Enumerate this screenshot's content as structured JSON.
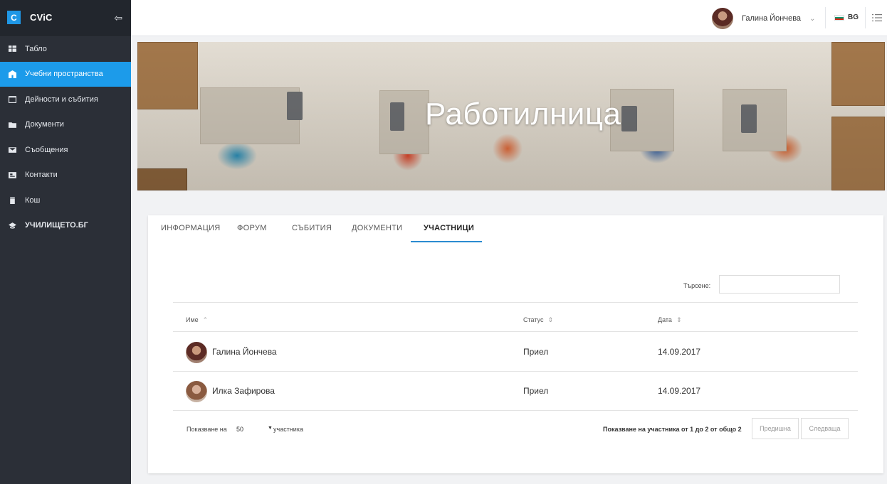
{
  "brand": {
    "logo_letter": "C",
    "name": "CViC"
  },
  "sidebar": {
    "items": [
      {
        "label": "Табло",
        "icon": "dashboard-icon"
      },
      {
        "label": "Учебни пространства",
        "icon": "building-icon",
        "active": true
      },
      {
        "label": "Дейности и събития",
        "icon": "calendar-icon"
      },
      {
        "label": "Документи",
        "icon": "folder-icon"
      },
      {
        "label": "Съобщения",
        "icon": "envelope-icon"
      },
      {
        "label": "Контакти",
        "icon": "contact-card-icon"
      },
      {
        "label": "Кош",
        "icon": "trash-icon"
      },
      {
        "label": "УЧИЛИЩЕТО.БГ",
        "icon": "graduation-cap-icon"
      }
    ]
  },
  "topbar": {
    "user_name": "Галина Йончева",
    "language": "BG"
  },
  "banner": {
    "title": "Работилница"
  },
  "tabs": [
    {
      "label": "ИНФОРМАЦИЯ"
    },
    {
      "label": "ФОРУМ"
    },
    {
      "label": "СЪБИТИЯ"
    },
    {
      "label": "ДОКУМЕНТИ"
    },
    {
      "label": "УЧАСТНИЦИ",
      "active": true
    }
  ],
  "search": {
    "label": "Търсене:",
    "value": ""
  },
  "table": {
    "headers": {
      "name": "Име",
      "status": "Статус",
      "date": "Дата"
    },
    "rows": [
      {
        "name": "Галина Йончева",
        "status": "Приел",
        "date": "14.09.2017"
      },
      {
        "name": "Илка Зафирова",
        "status": "Приел",
        "date": "14.09.2017"
      }
    ]
  },
  "footer": {
    "show_label": "Показване на",
    "page_size": "50",
    "show_suffix": "участника",
    "info": "Показване на участника от 1 до 2 от общо 2",
    "prev_label": "Предишна",
    "next_label": "Следваща"
  },
  "colors": {
    "sidebar_bg": "#2b2f37",
    "accent": "#1c9bea",
    "tab_underline": "#2b8bd1"
  }
}
